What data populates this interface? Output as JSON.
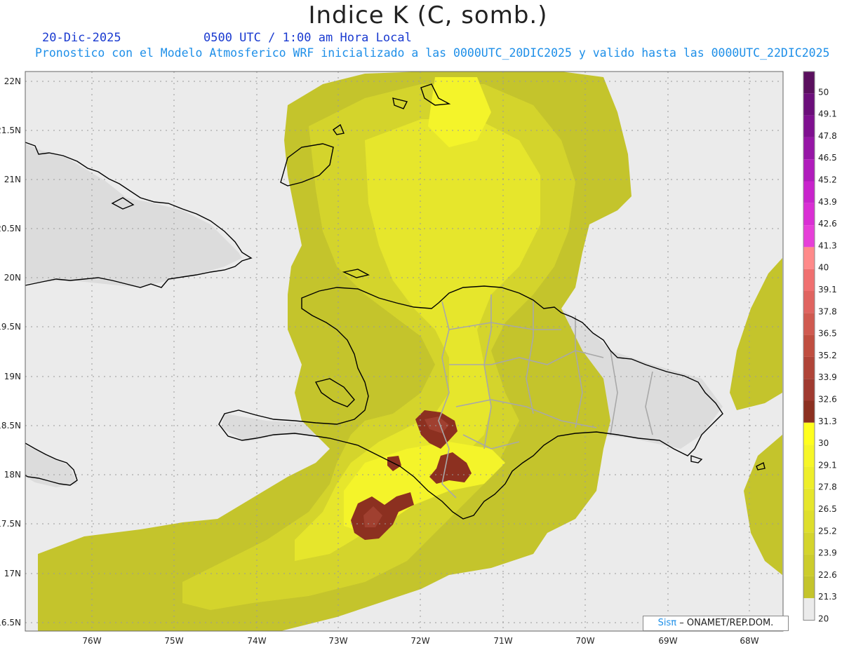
{
  "header": {
    "title": "Indice K (C, somb.)",
    "date": "20-Dic-2025",
    "time": "0500 UTC / 1:00 am Hora Local",
    "info": "Pronostico con el Modelo Atmosferico WRF inicializado a las 0000UTC_20DIC2025 y valido hasta las  0000UTC_22DIC2025"
  },
  "axes": {
    "lat_labels": [
      "22N",
      "21.5N",
      "21N",
      "20.5N",
      "20N",
      "19.5N",
      "19N",
      "18.5N",
      "18N",
      "17.5N",
      "17N",
      "16.5N"
    ],
    "lon_labels": [
      "76W",
      "75W",
      "74W",
      "73W",
      "72W",
      "71W",
      "70W",
      "69W",
      "68W"
    ]
  },
  "colorbar": {
    "labels": [
      "50",
      "49.1",
      "47.8",
      "46.5",
      "45.2",
      "43.9",
      "42.6",
      "41.3",
      "40",
      "39.1",
      "37.8",
      "36.5",
      "35.2",
      "33.9",
      "32.6",
      "31.3",
      "30",
      "29.1",
      "27.8",
      "26.5",
      "25.2",
      "23.9",
      "22.6",
      "21.3",
      "20"
    ],
    "colors": [
      "#5a0f5e",
      "#6b0e7a",
      "#7f1090",
      "#9616a6",
      "#b01cbc",
      "#c824cc",
      "#d92fd4",
      "#e63fd8",
      "#ff8a8a",
      "#f07070",
      "#e06460",
      "#d05a50",
      "#c04e40",
      "#b04438",
      "#a03a30",
      "#8c3020",
      "#ffff1e",
      "#f6f628",
      "#eeee2a",
      "#e6e62c",
      "#dede2c",
      "#d4d42c",
      "#cccc2c",
      "#c4c42c",
      "#ebebeb"
    ]
  },
  "colors": {
    "ocean": "#ebebeb",
    "land": "#dcdcdc",
    "k20": "#c4c42c",
    "k24": "#d4d42c",
    "k27": "#e6e62c",
    "k29": "#f4f42a",
    "k31": "#8c3020",
    "k33": "#a04030",
    "coast": "#000000",
    "border": "#a8a8a8"
  },
  "credit": {
    "logo": "Sisπ",
    "text": "– ONAMET/REP.DOM."
  }
}
